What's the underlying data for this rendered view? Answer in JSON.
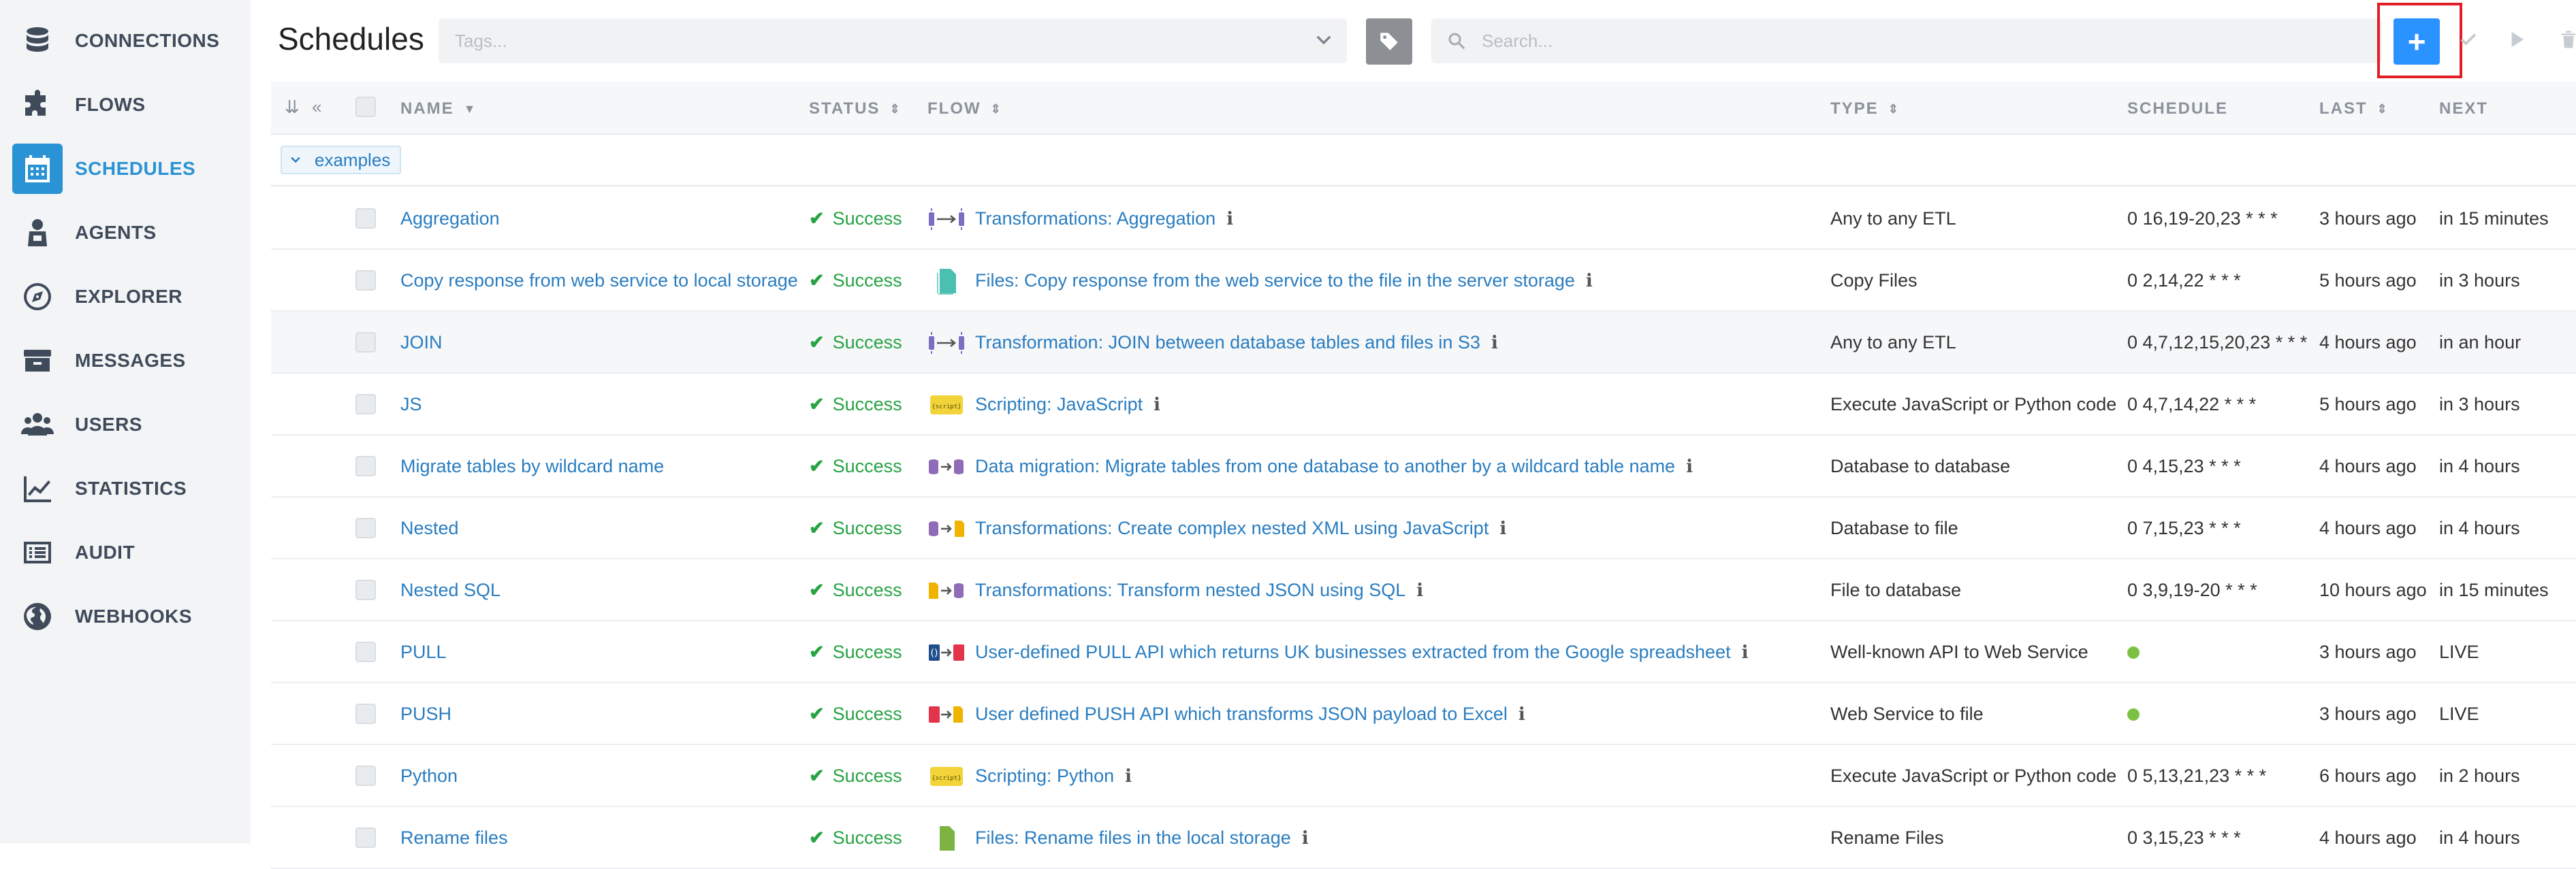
{
  "sidebar": {
    "items": [
      {
        "label": "CONNECTIONS",
        "icon": "database-icon"
      },
      {
        "label": "FLOWS",
        "icon": "puzzle-icon"
      },
      {
        "label": "SCHEDULES",
        "icon": "calendar-icon",
        "active": true
      },
      {
        "label": "AGENTS",
        "icon": "agent-icon"
      },
      {
        "label": "EXPLORER",
        "icon": "compass-icon"
      },
      {
        "label": "MESSAGES",
        "icon": "inbox-icon"
      },
      {
        "label": "USERS",
        "icon": "users-icon"
      },
      {
        "label": "STATISTICS",
        "icon": "chart-icon"
      },
      {
        "label": "AUDIT",
        "icon": "list-icon"
      },
      {
        "label": "WEBHOOKS",
        "icon": "globe-icon"
      }
    ]
  },
  "header": {
    "title": "Schedules",
    "tags_placeholder": "Tags...",
    "search_placeholder": "Search...",
    "add_label": "+"
  },
  "table": {
    "columns": {
      "name": "NAME",
      "status": "STATUS",
      "flow": "FLOW",
      "type": "TYPE",
      "schedule": "SCHEDULE",
      "last": "LAST",
      "next": "NEXT"
    },
    "group": "examples",
    "rows": [
      {
        "name": "Aggregation",
        "status": "Success",
        "flow_icon": "etl-icon",
        "flow": "Transformations: Aggregation",
        "type": "Any to any ETL",
        "schedule": "0 16,19-20,23 * * *",
        "last": "3 hours ago",
        "next": "in 15 minutes"
      },
      {
        "name": "Copy response from web service to local storage",
        "status": "Success",
        "flow_icon": "files-icon",
        "flow": "Files: Copy response from the web service to the file in the server storage",
        "type": "Copy Files",
        "schedule": "0 2,14,22 * * *",
        "last": "5 hours ago",
        "next": "in 3 hours"
      },
      {
        "name": "JOIN",
        "status": "Success",
        "flow_icon": "etl-icon",
        "flow": "Transformation: JOIN between database tables and files in S3",
        "type": "Any to any ETL",
        "schedule": "0 4,7,12,15,20,23 * * *",
        "last": "4 hours ago",
        "next": "in an hour"
      },
      {
        "name": "JS",
        "status": "Success",
        "flow_icon": "script-icon",
        "flow": "Scripting: JavaScript",
        "type": "Execute JavaScript or Python code",
        "schedule": "0 4,7,14,22 * * *",
        "last": "5 hours ago",
        "next": "in 3 hours"
      },
      {
        "name": "Migrate tables by wildcard name",
        "status": "Success",
        "flow_icon": "db-to-db-icon",
        "flow": "Data migration: Migrate tables from one database to another by a wildcard table name",
        "type": "Database to database",
        "schedule": "0 4,15,23 * * *",
        "last": "4 hours ago",
        "next": "in 4 hours"
      },
      {
        "name": "Nested",
        "status": "Success",
        "flow_icon": "db-to-file-icon",
        "flow": "Transformations: Create complex nested XML using JavaScript",
        "type": "Database to file",
        "schedule": "0 7,15,23 * * *",
        "last": "4 hours ago",
        "next": "in 4 hours"
      },
      {
        "name": "Nested SQL",
        "status": "Success",
        "flow_icon": "file-to-db-icon",
        "flow": "Transformations: Transform nested JSON using SQL",
        "type": "File to database",
        "schedule": "0 3,9,19-20 * * *",
        "last": "10 hours ago",
        "next": "in 15 minutes"
      },
      {
        "name": "PULL",
        "status": "Success",
        "flow_icon": "api-pull-icon",
        "flow": "User-defined PULL API which returns UK businesses extracted from the Google spreadsheet",
        "type": "Well-known API to Web Service",
        "schedule": "",
        "schedule_dot": true,
        "last": "3 hours ago",
        "next": "LIVE"
      },
      {
        "name": "PUSH",
        "status": "Success",
        "flow_icon": "api-push-icon",
        "flow": "User defined PUSH API which transforms JSON payload to Excel",
        "type": "Web Service to file",
        "schedule": "",
        "schedule_dot": true,
        "last": "3 hours ago",
        "next": "LIVE"
      },
      {
        "name": "Python",
        "status": "Success",
        "flow_icon": "script-icon",
        "flow": "Scripting: Python",
        "type": "Execute JavaScript or Python code",
        "schedule": "0 5,13,21,23 * * *",
        "last": "6 hours ago",
        "next": "in 2 hours"
      },
      {
        "name": "Rename files",
        "status": "Success",
        "flow_icon": "file-icon",
        "flow": "Files: Rename files in the local storage",
        "type": "Rename Files",
        "schedule": "0 3,15,23 * * *",
        "last": "4 hours ago",
        "next": "in 4 hours"
      }
    ]
  },
  "colors": {
    "accent": "#2a93d5",
    "success": "#27a344",
    "highlight": "#e21d24",
    "add_button": "#2a93ff"
  }
}
